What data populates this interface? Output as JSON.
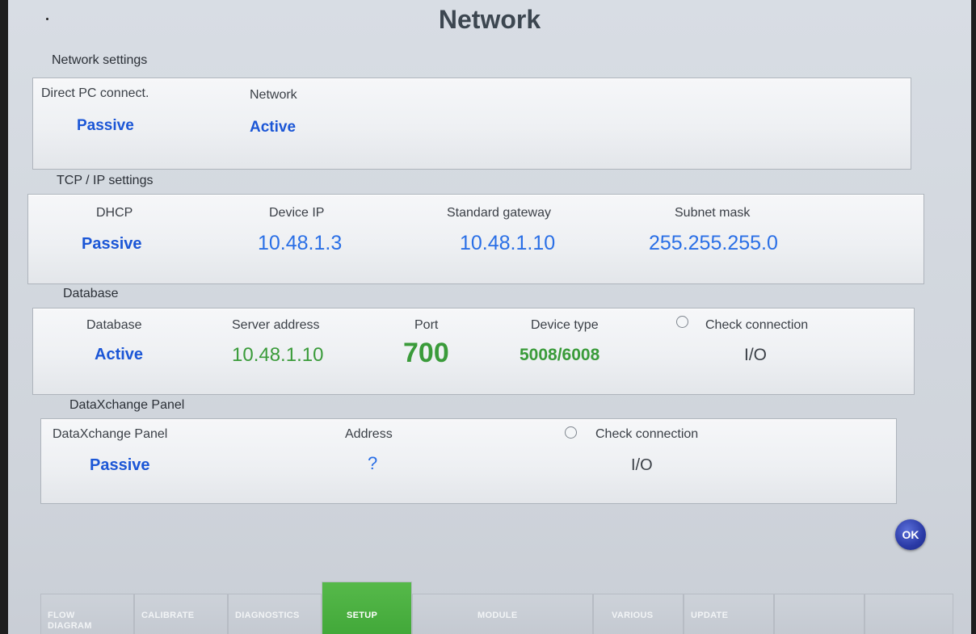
{
  "screen": {
    "title": "Network"
  },
  "network_settings": {
    "section_label": "Network settings",
    "direct_pc": {
      "label": "Direct PC connect.",
      "value": "Passive"
    },
    "network": {
      "label": "Network",
      "value": "Active"
    }
  },
  "tcpip": {
    "section_label": "TCP / IP settings",
    "dhcp": {
      "label": "DHCP",
      "value": "Passive"
    },
    "device_ip": {
      "label": "Device IP",
      "value": "10.48.1.3"
    },
    "gateway": {
      "label": "Standard gateway",
      "value": "10.48.1.10"
    },
    "subnet": {
      "label": "Subnet mask",
      "value": "255.255.255.0"
    }
  },
  "database": {
    "section_label": "Database",
    "database": {
      "label": "Database",
      "value": "Active"
    },
    "server": {
      "label": "Server address",
      "value": "10.48.1.10"
    },
    "port": {
      "label": "Port",
      "value": "700"
    },
    "device_type": {
      "label": "Device type",
      "value": "5008/6008"
    },
    "check": {
      "label": "Check connection",
      "value": "I/O"
    }
  },
  "dataxchange": {
    "section_label": "DataXchange Panel",
    "panel": {
      "label": "DataXchange Panel",
      "value": "Passive"
    },
    "address": {
      "label": "Address",
      "value": "?"
    },
    "check": {
      "label": "Check connection",
      "value": "I/O"
    }
  },
  "ok_button": "OK",
  "tabs": [
    {
      "label": "FLOW DIAGRAM",
      "active": false
    },
    {
      "label": "CALIBRATE",
      "active": false
    },
    {
      "label": "DIAGNOSTICS",
      "active": false
    },
    {
      "label": "SETUP",
      "active": true
    },
    {
      "label": "MODULE",
      "active": false
    },
    {
      "label": "VARIOUS",
      "active": false
    },
    {
      "label": "UPDATE",
      "active": false
    },
    {
      "label": "",
      "active": false
    },
    {
      "label": "",
      "active": false
    }
  ],
  "colors": {
    "value_blue": "#1b56d6",
    "value_green": "#3a9b3a",
    "tab_active": "#4cb043",
    "ok_button": "#2a3aa6"
  }
}
